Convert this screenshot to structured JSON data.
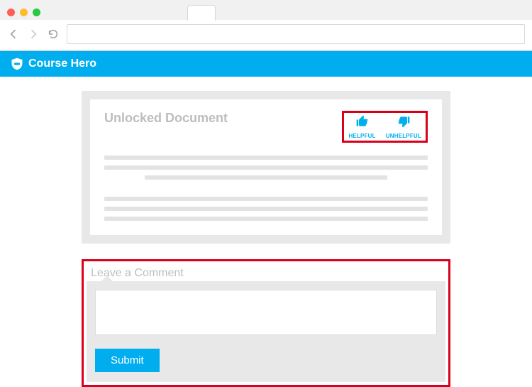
{
  "browser": {
    "url": ""
  },
  "header": {
    "brand": "Course Hero"
  },
  "document": {
    "title": "Unlocked Document",
    "rating": {
      "helpful_label": "HELPFUL",
      "unhelpful_label": "UNHELPFUL"
    }
  },
  "comment": {
    "title": "Leave a Comment",
    "textarea_value": "",
    "submit_label": "Submit"
  },
  "colors": {
    "brand": "#00aeef",
    "highlight": "#d9001b"
  }
}
